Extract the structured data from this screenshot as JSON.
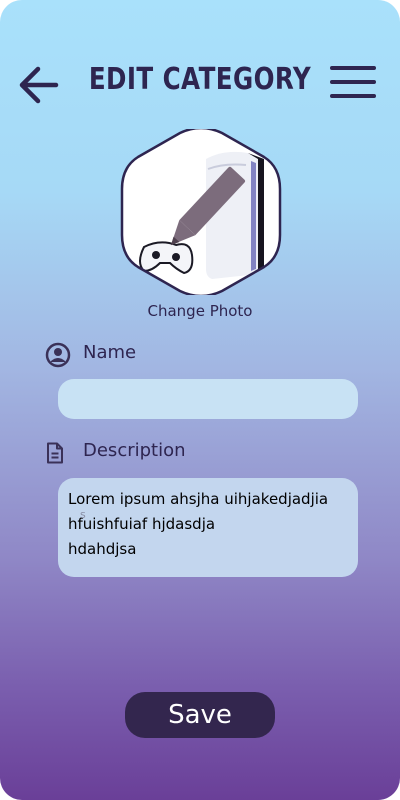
{
  "header": {
    "title": "EDIT CATEGORY",
    "back_icon": "arrow-left-icon",
    "menu_icon": "hamburger-menu-icon"
  },
  "photo": {
    "change_label": "Change Photo",
    "overlay_icon": "pencil-icon",
    "image_subject": "game console with controller"
  },
  "form": {
    "name": {
      "label": "Name",
      "icon": "user-circle-icon",
      "value": ""
    },
    "description": {
      "label": "Description",
      "icon": "document-icon",
      "value_lines": [
        "Lorem ipsum ahsjha uihjakedjadjia",
        "hfuishfuiaf hjdasdja",
        "hdahdjsa"
      ],
      "ghost_char": "s"
    }
  },
  "actions": {
    "save_label": "Save"
  },
  "colors": {
    "primary": "#2e2550",
    "button": "#33264e",
    "input_bg": "#c8e2f4",
    "textarea_bg": "#c3d6ee",
    "gradient_top": "#a9e1fb",
    "gradient_bottom": "#6a3f98"
  }
}
